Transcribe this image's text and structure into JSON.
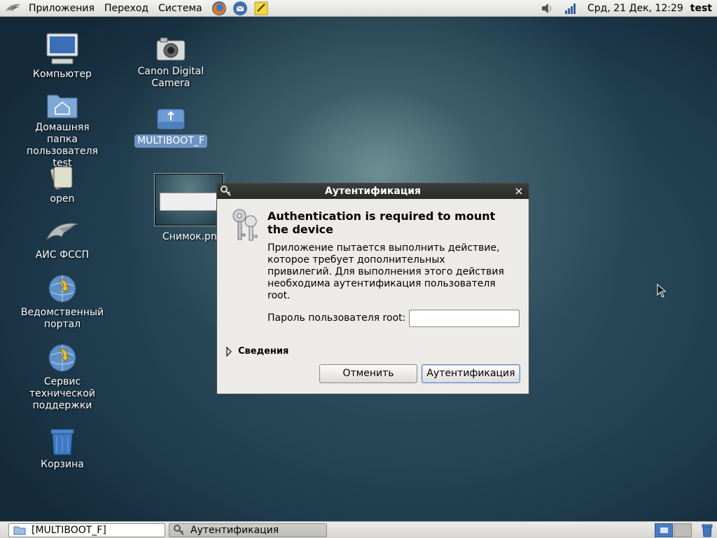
{
  "top_panel": {
    "menus": [
      "Приложения",
      "Переход",
      "Система"
    ],
    "clock": "Срд, 21 Дек, 12:29",
    "user": "test"
  },
  "desktop_icons": {
    "computer": "Компьютер",
    "home": "Домашняя папка пользователя test",
    "open": "open",
    "ais": "АИС ФССП",
    "portal": "Ведомственный портал",
    "support": "Сервис технической поддержки",
    "trash": "Корзина",
    "camera": "Canon Digital Camera",
    "usb": "MULTIBOOT_F",
    "screenshot": "Снимок.png"
  },
  "dialog": {
    "title": "Аутентификация",
    "heading": "Authentication is required to mount the device",
    "message": "Приложение пытается выполнить действие, которое требует дополнительных привилегий. Для выполнения этого действия необходима аутентификация пользователя root.",
    "password_label": "Пароль пользователя root:",
    "password_value": "",
    "details_label": "Сведения",
    "cancel_label": "Отменить",
    "ok_label": "Аутентификация"
  },
  "taskbar": {
    "tasks": [
      "[MULTIBOOT_F]",
      "Аутентификация"
    ]
  },
  "colors": {
    "dialog_title_bg": "#2f2f2d",
    "selection": "#6e93c2",
    "workspace_active": "#4a7ac0"
  }
}
